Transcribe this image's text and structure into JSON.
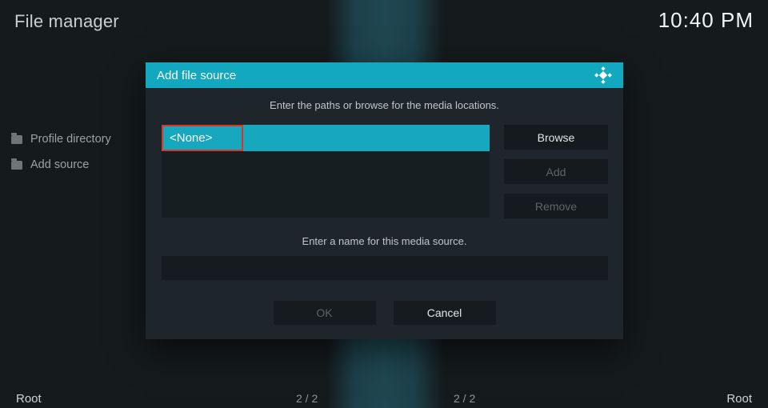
{
  "header": {
    "title": "File manager",
    "clock": "10:40 PM"
  },
  "sidebar": {
    "items": [
      {
        "label": "Profile directory"
      },
      {
        "label": "Add source"
      }
    ]
  },
  "dialog": {
    "title": "Add file source",
    "instruction_paths": "Enter the paths or browse for the media locations.",
    "path_value": "<None>",
    "browse_label": "Browse",
    "add_label": "Add",
    "remove_label": "Remove",
    "instruction_name": "Enter a name for this media source.",
    "name_value": "",
    "ok_label": "OK",
    "cancel_label": "Cancel"
  },
  "footer": {
    "left": "Root",
    "counter_left": "2 / 2",
    "counter_right": "2 / 2",
    "right": "Root"
  }
}
